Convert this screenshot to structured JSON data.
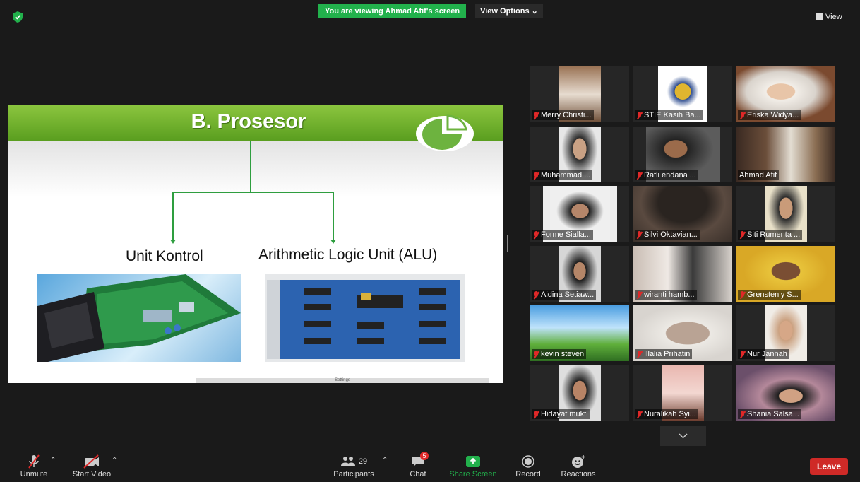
{
  "top": {
    "banner": "You are viewing Ahmad Afif's screen",
    "view_options": "View Options",
    "view_label": "View"
  },
  "slide": {
    "title": "B. Prosesor",
    "left_label": "Unit Kontrol",
    "right_label": "Arithmetic Logic Unit (ALU)",
    "footer_text": "Settings",
    "colors": {
      "header_green": "#6db33f",
      "line_green": "#2e9e3f"
    }
  },
  "participants": [
    {
      "name": "Merry Christi...",
      "muted": true
    },
    {
      "name": "STIE Kasih Ba...",
      "muted": true
    },
    {
      "name": "Eriska Widya...",
      "muted": true
    },
    {
      "name": "Muhammad ...",
      "muted": true
    },
    {
      "name": "Rafli endana ...",
      "muted": true
    },
    {
      "name": "Ahmad Afif",
      "muted": false
    },
    {
      "name": "Forme Sialla...",
      "muted": true
    },
    {
      "name": "Silvi Oktavian...",
      "muted": true
    },
    {
      "name": "Siti Rumenta ...",
      "muted": true
    },
    {
      "name": "Aidina Setiaw...",
      "muted": true
    },
    {
      "name": "wiranti hamb...",
      "muted": true
    },
    {
      "name": "Grenstenly S...",
      "muted": true
    },
    {
      "name": "kevin steven",
      "muted": true
    },
    {
      "name": "Illalia Prihatin",
      "muted": true
    },
    {
      "name": "Nur Jannah",
      "muted": true
    },
    {
      "name": "Hidayat mukti",
      "muted": true
    },
    {
      "name": "Nuralikah Syi...",
      "muted": true
    },
    {
      "name": "Shania Salsa...",
      "muted": true
    }
  ],
  "toolbar": {
    "unmute": "Unmute",
    "start_video": "Start Video",
    "participants_label": "Participants",
    "participants_count": "29",
    "chat": "Chat",
    "chat_badge": "5",
    "share_screen": "Share Screen",
    "record": "Record",
    "reactions": "Reactions",
    "leave": "Leave",
    "accent_green": "#22b14c",
    "leave_red": "#cf2a27"
  }
}
